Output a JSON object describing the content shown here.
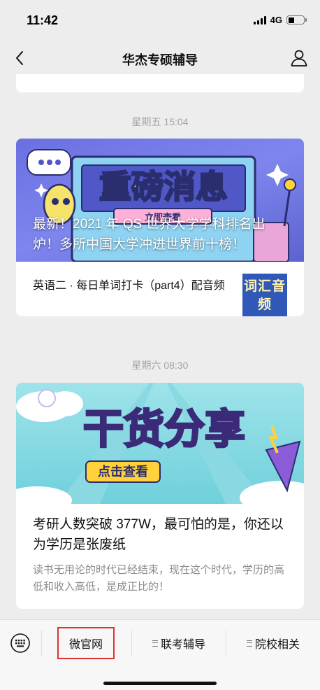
{
  "status_bar": {
    "time": "11:42",
    "network": "4G",
    "battery_level": 0.4
  },
  "nav": {
    "title": "华杰专硕辅导",
    "back_icon": "chevron-left-icon",
    "profile_icon": "person-icon"
  },
  "messages": [
    {
      "timestamp": "星期五 15:04",
      "hero": {
        "banner_text": "重磅消息",
        "banner_sub": "立即查看",
        "title": "最新！2021 年 QS 世界大学学科排名出炉！多所中国大学冲进世界前十榜！"
      },
      "items": [
        {
          "title": "英语二 · 每日单词打卡（part4）配音频",
          "thumb_text": "词汇音频"
        }
      ]
    },
    {
      "timestamp": "星期六 08:30",
      "hero": {
        "banner_text": "干货分享",
        "banner_sub": "点击查看"
      },
      "title": "考研人数突破 377W，最可怕的是，你还以为学历是张废纸",
      "summary": "读书无用论的时代已经结束，现在这个时代，学历的高低和收入高低，是成正比的！"
    }
  ],
  "bottom_menu": {
    "keyboard_icon": "keyboard-icon",
    "items": [
      {
        "label": "微官网",
        "highlighted": true
      },
      {
        "label": "联考辅导"
      },
      {
        "label": "院校相关"
      }
    ]
  },
  "colors": {
    "highlight": "#e03030",
    "background": "#ededed",
    "hero1": "#6b6fe0",
    "hero2": "#6fd0db",
    "banner_text": "#ffd23c"
  }
}
